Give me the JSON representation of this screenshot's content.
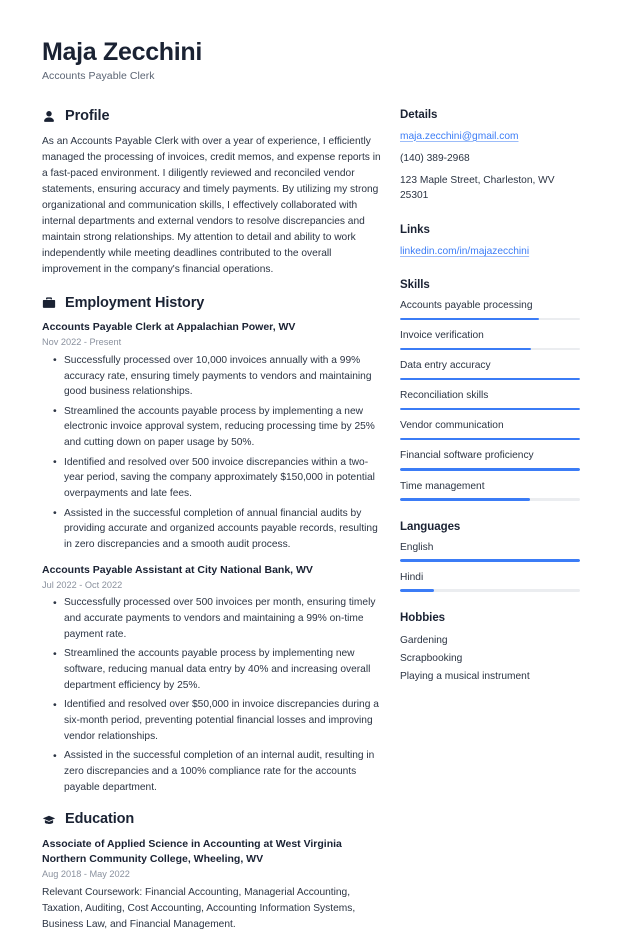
{
  "header": {
    "name": "Maja Zecchini",
    "title": "Accounts Payable Clerk"
  },
  "theme": {
    "accent": "#3b7cf6",
    "text": "#2b3443",
    "heading": "#1a2233",
    "muted": "#8a919e",
    "track": "#ebedf0"
  },
  "profile": {
    "icon": "user-icon",
    "heading": "Profile",
    "text": "As an Accounts Payable Clerk with over a year of experience, I efficiently managed the processing of invoices, credit memos, and expense reports in a fast-paced environment. I diligently reviewed and reconciled vendor statements, ensuring accuracy and timely payments. By utilizing my strong organizational and communication skills, I effectively collaborated with internal departments and external vendors to resolve discrepancies and maintain strong relationships. My attention to detail and ability to work independently while meeting deadlines contributed to the overall improvement in the company's financial operations."
  },
  "employment": {
    "icon": "briefcase-icon",
    "heading": "Employment History",
    "jobs": [
      {
        "title": "Accounts Payable Clerk at Appalachian Power, WV",
        "date": "Nov 2022 - Present",
        "bullets": [
          "Successfully processed over 10,000 invoices annually with a 99% accuracy rate, ensuring timely payments to vendors and maintaining good business relationships.",
          "Streamlined the accounts payable process by implementing a new electronic invoice approval system, reducing processing time by 25% and cutting down on paper usage by 50%.",
          "Identified and resolved over 500 invoice discrepancies within a two-year period, saving the company approximately $150,000 in potential overpayments and late fees.",
          "Assisted in the successful completion of annual financial audits by providing accurate and organized accounts payable records, resulting in zero discrepancies and a smooth audit process."
        ]
      },
      {
        "title": "Accounts Payable Assistant at City National Bank, WV",
        "date": "Jul 2022 - Oct 2022",
        "bullets": [
          "Successfully processed over 500 invoices per month, ensuring timely and accurate payments to vendors and maintaining a 99% on-time payment rate.",
          "Streamlined the accounts payable process by implementing new software, reducing manual data entry by 40% and increasing overall department efficiency by 25%.",
          "Identified and resolved over $50,000 in invoice discrepancies during a six-month period, preventing potential financial losses and improving vendor relationships.",
          "Assisted in the successful completion of an internal audit, resulting in zero discrepancies and a 100% compliance rate for the accounts payable department."
        ]
      }
    ]
  },
  "education": {
    "icon": "graduation-cap-icon",
    "heading": "Education",
    "entries": [
      {
        "title": "Associate of Applied Science in Accounting at West Virginia Northern Community College, Wheeling, WV",
        "date": "Aug 2018 - May 2022",
        "description": "Relevant Coursework: Financial Accounting, Managerial Accounting, Taxation, Auditing, Cost Accounting, Accounting Information Systems, Business Law, and Financial Management."
      }
    ]
  },
  "details": {
    "heading": "Details",
    "email": "maja.zecchini@gmail.com",
    "phone": "(140) 389-2968",
    "address": "123 Maple Street, Charleston, WV 25301"
  },
  "links": {
    "heading": "Links",
    "items": [
      {
        "label": "linkedin.com/in/majazecchini"
      }
    ]
  },
  "skills": {
    "heading": "Skills",
    "items": [
      {
        "label": "Accounts payable processing",
        "level": 77
      },
      {
        "label": "Invoice verification",
        "level": 73
      },
      {
        "label": "Data entry accuracy",
        "level": 100
      },
      {
        "label": "Reconciliation skills",
        "level": 100
      },
      {
        "label": "Vendor communication",
        "level": 100
      },
      {
        "label": "Financial software proficiency",
        "level": 100
      },
      {
        "label": "Time management",
        "level": 72
      }
    ]
  },
  "languages": {
    "heading": "Languages",
    "items": [
      {
        "label": "English",
        "level": 100
      },
      {
        "label": "Hindi",
        "level": 19
      }
    ]
  },
  "hobbies": {
    "heading": "Hobbies",
    "items": [
      {
        "label": "Gardening"
      },
      {
        "label": "Scrapbooking"
      },
      {
        "label": "Playing a musical instrument"
      }
    ]
  }
}
